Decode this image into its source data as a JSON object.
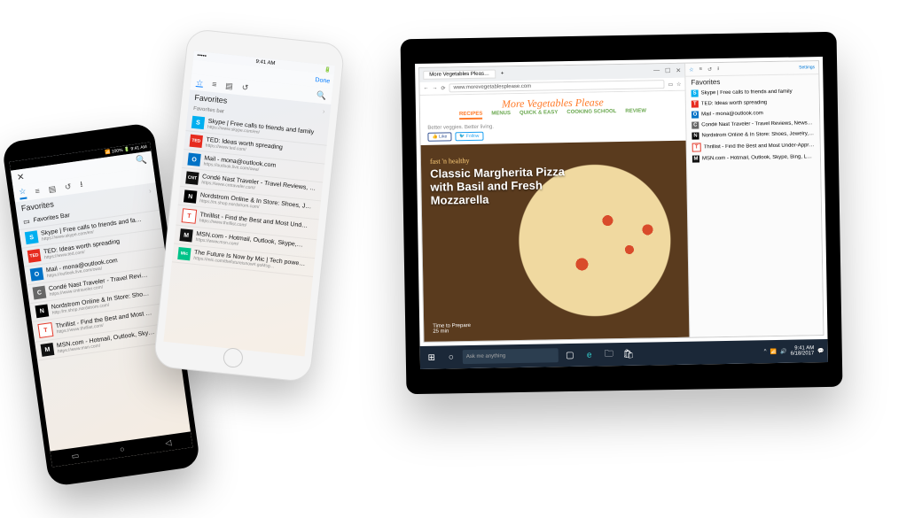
{
  "iphone": {
    "status": {
      "time": "9:41 AM",
      "done": "Done"
    },
    "tabs": {
      "star": "☆",
      "list": "≡",
      "books": "▤",
      "history": "↺",
      "dl": "⭳",
      "search": "🔍"
    },
    "title": "Favorites",
    "section": "Favorites bar",
    "items": [
      {
        "ico": "S",
        "bg": "#00aff0",
        "title": "Skype | Free calls to friends and family",
        "url": "https://www.skype.com/en/"
      },
      {
        "ico": "TED",
        "bg": "#e62b1e",
        "fs": "5px",
        "title": "TED: Ideas worth spreading",
        "url": "https://www.ted.com/"
      },
      {
        "ico": "O",
        "bg": "#0072c6",
        "title": "Mail - mona@outlook.com",
        "url": "https://outlook.live.com/owa/"
      },
      {
        "ico": "CNT",
        "bg": "#111",
        "fs": "5px",
        "title": "Condé Nast Traveler - Travel Reviews, …",
        "url": "https://www.cntraveler.com/"
      },
      {
        "ico": "N",
        "bg": "#000",
        "title": "Nordstrom Online & In Store: Shoes, J…",
        "url": "https://m.shop.nordstrom.com/"
      },
      {
        "ico": "T",
        "bg": "#fff",
        "fg": "#e53b2c",
        "bd": "#e53b2c",
        "title": "Thrillist - Find the Best and Most Und…",
        "url": "https://www.thrillist.com/"
      },
      {
        "ico": "M",
        "bg": "#111",
        "title": "MSN.com - Hotmail, Outlook, Skype,…",
        "url": "https://www.msn.com/"
      },
      {
        "ico": "Mic",
        "bg": "#00c389",
        "fs": "5px",
        "title": "The Future Is Now by Mic | Tech powe…",
        "url": "https://mic.com/thefutureisnow#.goMsg…"
      }
    ]
  },
  "android": {
    "status": "📶 100% 🔋 9:41 AM",
    "close": "✕",
    "search": "🔍",
    "title": "Favorites",
    "barLabel": "Favorites Bar",
    "items": [
      {
        "ico": "S",
        "bg": "#00aff0",
        "title": "Skype | Free calls to friends and fa…",
        "url": "https://www.skype.com/en/"
      },
      {
        "ico": "TED",
        "bg": "#e62b1e",
        "fs": "5px",
        "title": "TED: Ideas worth spreading",
        "url": "https://www.ted.com/"
      },
      {
        "ico": "O",
        "bg": "#0072c6",
        "title": "Mail - mona@outlook.com",
        "url": "https://outlook.live.com/owa/"
      },
      {
        "ico": "C",
        "bg": "#666",
        "title": "Condé Nast Traveler - Travel Revi…",
        "url": "https://www.cntraveler.com/"
      },
      {
        "ico": "N",
        "bg": "#000",
        "title": "Nordstrom Online & In Store: Sho…",
        "url": "http://m.shop.nordstrom.com/"
      },
      {
        "ico": "T",
        "bg": "#fff",
        "fg": "#e53b2c",
        "bd": "#e53b2c",
        "title": "Thrillist - Find the Best and Most …",
        "url": "https://www.thrillist.com/"
      },
      {
        "ico": "M",
        "bg": "#111",
        "title": "MSN.com - Hotmail, Outlook, Sky…",
        "url": "https://www.msn.com/"
      }
    ],
    "nav": {
      "recent": "▭",
      "home": "○",
      "back": "◁"
    }
  },
  "tablet": {
    "tabTitle": "More Vegetables Pleas…",
    "newTab": "+",
    "url": "www.morevegetablesplease.com",
    "winControls": [
      "—",
      "☐",
      "✕"
    ],
    "siteTitle": "More Vegetables Please",
    "nav": [
      "RECIPES",
      "MENUS",
      "QUICK & EASY",
      "COOKING SCHOOL",
      "REVIEW"
    ],
    "activeNav": 0,
    "tagline": "Better veggies. Better living.",
    "social": {
      "like": "👍 Like",
      "follow": "🐦 Follow"
    },
    "hero": {
      "label": "fast 'n healthy",
      "title": "Classic Margherita Pizza with Basil and Fresh Mozzarella",
      "meta": "Time to Prepare\n25 min"
    },
    "favPanel": {
      "settings": "Settings",
      "title": "Favorites",
      "items": [
        {
          "ico": "S",
          "bg": "#00aff0",
          "t": "Skype | Free calls to friends and family"
        },
        {
          "ico": "T",
          "bg": "#e62b1e",
          "t": "TED: Ideas worth spreading"
        },
        {
          "ico": "O",
          "bg": "#0072c6",
          "t": "Mail - mona@outlook.com"
        },
        {
          "ico": "C",
          "bg": "#666",
          "t": "Condé Nast Traveler - Travel Reviews, News, Guides"
        },
        {
          "ico": "N",
          "bg": "#000",
          "t": "Nordstrom Online & In Store: Shoes, Jewelry, Cloth…"
        },
        {
          "ico": "T",
          "bg": "#fff",
          "fg": "#e53b2c",
          "bd": "#e53b2c",
          "t": "Thrillist - Find the Best and Most Under-Appreciated …"
        },
        {
          "ico": "M",
          "bg": "#111",
          "t": "MSN.com - Hotmail, Outlook, Skype, Bing, Latest New…"
        }
      ]
    },
    "taskbar": {
      "search": "Ask me anything",
      "time": "9:41 AM",
      "date": "6/18/2017"
    }
  }
}
